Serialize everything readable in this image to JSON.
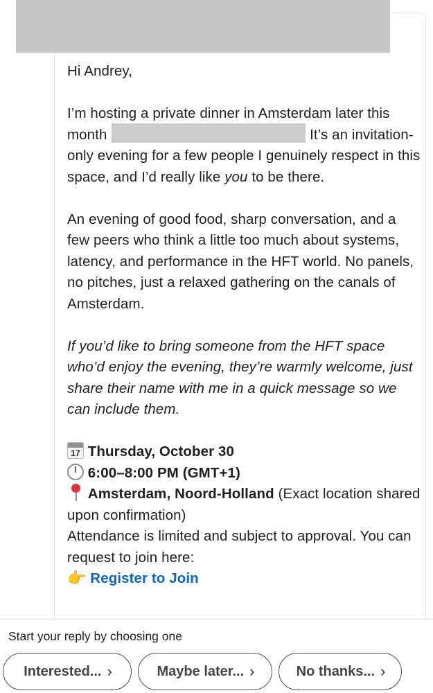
{
  "message": {
    "greeting": "Hi Andrey,",
    "para1_a": "I’m hosting a private dinner in Amsterdam later this month",
    "para1_b": "It’s an invitation-only evening for a few people I genuinely respect in this space, and I’d really like",
    "para1_you": "you",
    "para1_c": "to be there.",
    "para2": "An evening of good food, sharp conversation, and a few peers who think a little too much about systems, latency, and performance in the HFT world. No panels, no pitches, just a relaxed gathering on the canals of Amsterdam.",
    "para3": "If you’d like to bring someone from the HFT space who’d enjoy the evening, they’re warmly welcome, just share their name with me in a quick message so we can include them.",
    "date": "Thursday, October 30",
    "calendar_day": "17",
    "time": "6:00–8:00 PM (GMT+1)",
    "location_bold": "Amsterdam, Noord-Holland",
    "location_rest": "(Exact location shared upon confirmation)",
    "attendance": "Attendance is limited and subject to approval. You can request to join here:",
    "register_label": "Register to Join"
  },
  "reply": {
    "prompt": "Start your reply by choosing one",
    "options": [
      {
        "label": "Interested..."
      },
      {
        "label": "Maybe later..."
      },
      {
        "label": "No thanks..."
      }
    ]
  },
  "colors": {
    "link": "#0a66c2",
    "redaction": "#c6c6c6"
  }
}
